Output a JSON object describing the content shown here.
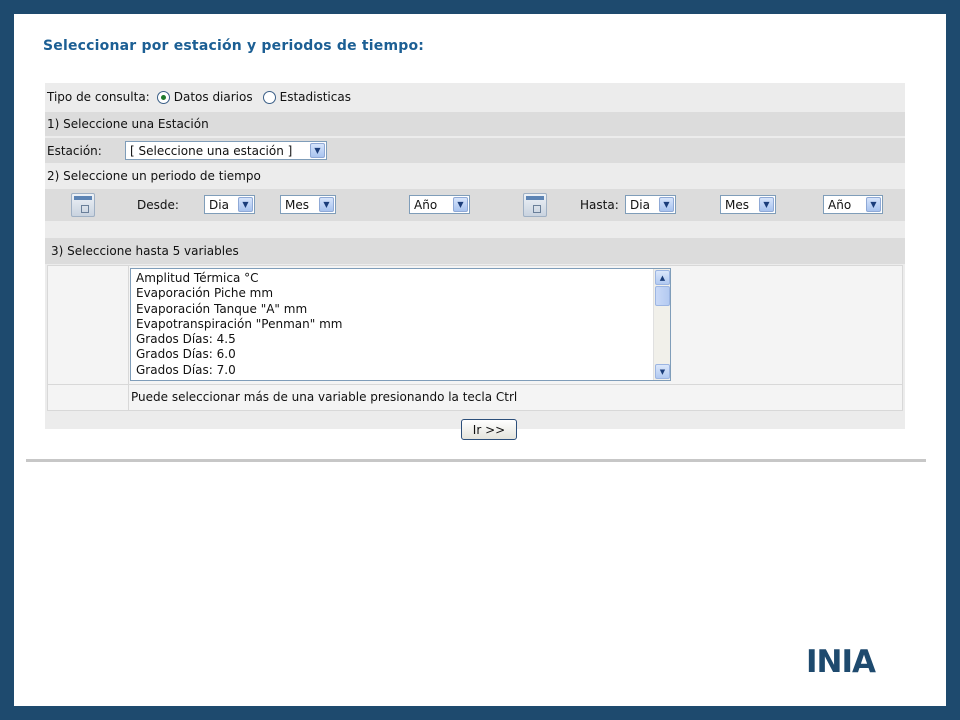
{
  "page_title": "Seleccionar por estación y periodos de tiempo:",
  "query_type": {
    "label": "Tipo de consulta:",
    "options": [
      {
        "label": "Datos diarios",
        "selected": true
      },
      {
        "label": "Estadisticas",
        "selected": false
      }
    ]
  },
  "step1": {
    "heading": "1) Seleccione una Estación",
    "station_label": "Estación:",
    "station_value": "[ Seleccione una estación ]"
  },
  "step2": {
    "heading": "2) Seleccione un periodo de tiempo",
    "from_label": "Desde:",
    "to_label": "Hasta:",
    "from": {
      "day": "Dia",
      "month": "Mes",
      "year": "Año"
    },
    "to": {
      "day": "Dia",
      "month": "Mes",
      "year": "Año"
    }
  },
  "step3": {
    "heading": "3) Seleccione hasta 5 variables",
    "variables": [
      "Amplitud Térmica °C",
      "Evaporación Piche mm",
      "Evaporación Tanque \"A\" mm",
      "Evapotranspiración \"Penman\" mm",
      "Grados Días: 4.5",
      "Grados Días: 6.0",
      "Grados Días: 7.0"
    ],
    "hint": "Puede seleccionar más de una variable presionando la tecla Ctrl"
  },
  "submit_label": "Ir >>",
  "logo_text": "INIA",
  "colors": {
    "frame": "#1e4a6e",
    "title": "#1c5f94",
    "row_dark": "#dcdcdc",
    "row_light": "#ececec"
  }
}
